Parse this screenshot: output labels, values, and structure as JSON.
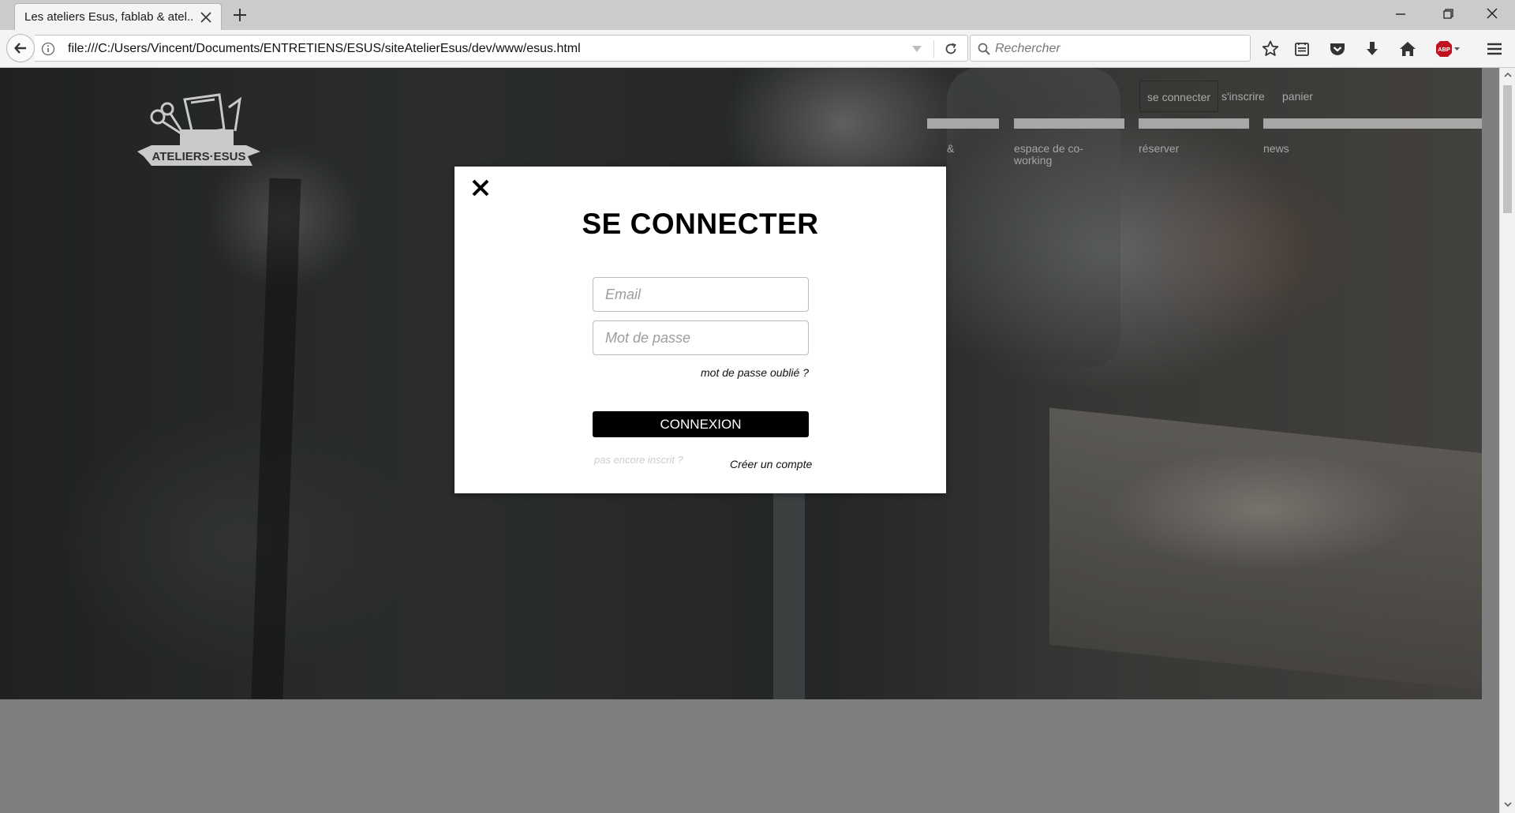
{
  "browser": {
    "tab_title": "Les ateliers Esus, fablab & atel...",
    "url": "file:///C:/Users/Vincent/Documents/ENTRETIENS/ESUS/siteAtelierEsus/dev/www/esus.html",
    "search_placeholder": "Rechercher",
    "adblock_label": "ABP"
  },
  "header": {
    "account_links": [
      "se connecter",
      "s'inscrire",
      "panier"
    ],
    "menu_items": [
      "&",
      "espace de co-working",
      "réserver",
      "news"
    ],
    "logo_text": "ATELIERS·ESUS"
  },
  "modal": {
    "title": "SE CONNECTER",
    "email_placeholder": "Email",
    "password_placeholder": "Mot de passe",
    "forgot_label": "mot de passe oublié ?",
    "submit_label": "CONNEXION",
    "not_registered": "pas encore inscrit ?",
    "create_account": "Créer un compte"
  },
  "colors": {
    "chrome_bg": "#f4f4f4",
    "tabbar_bg": "#cbcbcb",
    "submit_bg": "#000000",
    "page_gray": "#7f7f7f",
    "adblock_red": "#c1121f"
  }
}
